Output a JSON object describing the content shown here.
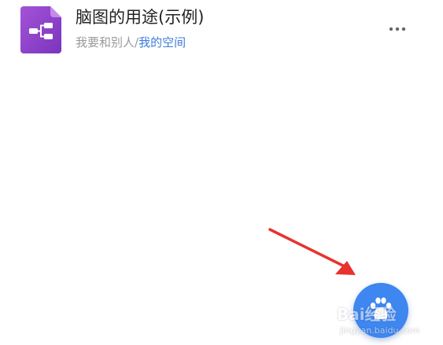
{
  "file": {
    "title": "脑图的用途(示例)",
    "path_prefix": "我要和别人/",
    "path_link": "我的空间",
    "icon": "mindmap-file-icon",
    "icon_color": "#8b3fc6"
  },
  "menu": {
    "icon": "more-horizontal-icon"
  },
  "fab": {
    "icon": "paw-icon",
    "color": "#3e86f0"
  },
  "annotation": {
    "icon": "red-arrow-icon",
    "color": "#e8322e"
  },
  "watermark": {
    "line1": "Bai经验",
    "line2": "jingyan.baidu.com"
  }
}
